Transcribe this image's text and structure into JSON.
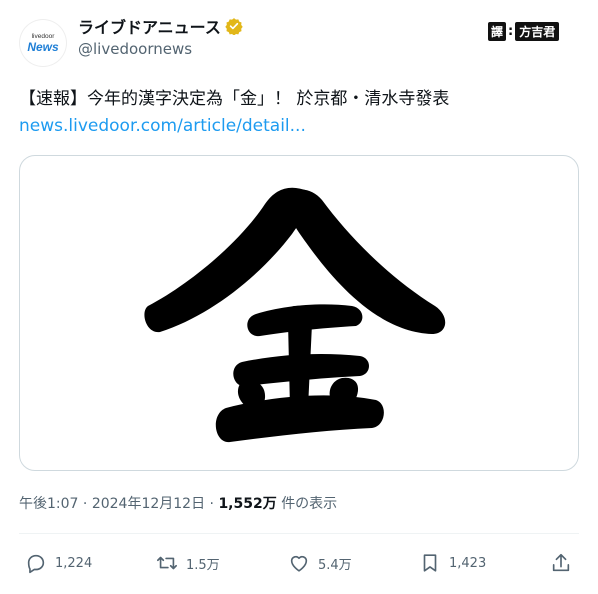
{
  "profile": {
    "avatar_small": "livedoor",
    "avatar_big": "News",
    "display_name": "ライブドアニュース",
    "handle": "@livedoornews",
    "verified_icon": "gold-verified-badge-icon"
  },
  "translator_badge": {
    "left": "譯",
    "right": "方吉君"
  },
  "tweet": {
    "text": "【速報】今年的漢字決定為「金」！ 於京都・清水寺發表",
    "link": "news.livedoor.com/article/detail..."
  },
  "meta": {
    "time": "午後1:07",
    "separator": "·",
    "date": "2024年12月12日",
    "views_count": "1,552万",
    "views_label": "件の表示"
  },
  "actions": {
    "reply": "1,224",
    "retweet": "1.5万",
    "like": "5.4万",
    "bookmark": "1,423"
  },
  "colors": {
    "link": "#1d9bf0",
    "muted": "#536471",
    "verified": "#e2b719"
  }
}
